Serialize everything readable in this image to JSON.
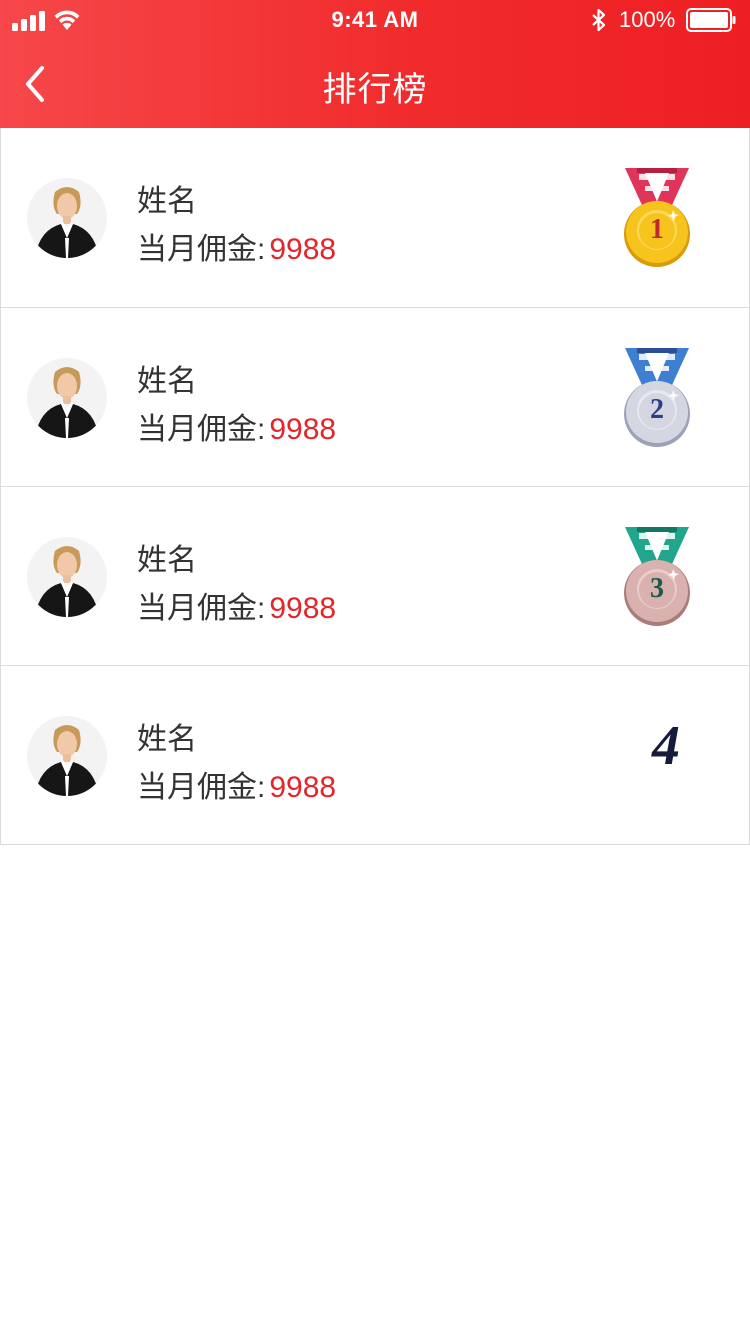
{
  "status_bar": {
    "time": "9:41 AM",
    "battery_percent": "100%",
    "icons": [
      "signal-icon",
      "wifi-icon",
      "bluetooth-icon",
      "battery-icon"
    ]
  },
  "nav": {
    "title": "排行榜",
    "back_icon": "chevron-left-icon"
  },
  "colors": {
    "header_start": "#f6474a",
    "header_end": "#ee1f23",
    "value_red": "#e2262b",
    "rank_text": "#161b3c"
  },
  "ranking": [
    {
      "name": "姓名",
      "commission_label": "当月佣金:",
      "commission_value": "9988",
      "rank": "1",
      "badge": "gold-medal-icon"
    },
    {
      "name": "姓名",
      "commission_label": "当月佣金:",
      "commission_value": "9988",
      "rank": "2",
      "badge": "silver-medal-icon"
    },
    {
      "name": "姓名",
      "commission_label": "当月佣金:",
      "commission_value": "9988",
      "rank": "3",
      "badge": "bronze-medal-icon"
    },
    {
      "name": "姓名",
      "commission_label": "当月佣金:",
      "commission_value": "9988",
      "rank": "4",
      "badge": "rank-number"
    }
  ]
}
